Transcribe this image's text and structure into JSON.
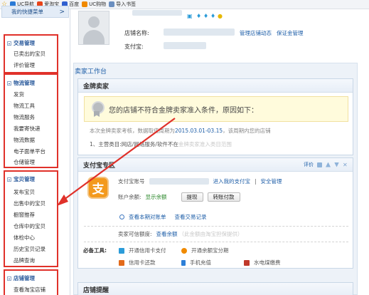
{
  "bookmarks": [
    {
      "label": "",
      "icon": "star-icon"
    },
    {
      "label": "UC导航",
      "icon": "uc-nav-icon",
      "color": "#2a7ad6"
    },
    {
      "label": "爱淘宝",
      "icon": "ai-taobao-icon",
      "color": "#e8441a"
    },
    {
      "label": "百度",
      "icon": "baidu-icon",
      "color": "#2f5fd0"
    },
    {
      "label": "UC购物",
      "icon": "uc-shopping-icon",
      "color": "#f08a00"
    },
    {
      "label": "导入书签",
      "icon": "import-bookmark-icon",
      "color": "#6b8fc0"
    }
  ],
  "sidebar": {
    "quick_menu": "我的快捷菜单",
    "quick_menu_arrow": ">",
    "groups": [
      {
        "title": "交易管理",
        "items": [
          "已卖出的宝贝",
          "评价管理"
        ]
      },
      {
        "title": "物流管理",
        "items": [
          "发货",
          "物流工具",
          "物流服务",
          "我要寄快递",
          "物流数据",
          "电子面单平台",
          "仓储管理"
        ]
      },
      {
        "title": "宝贝管理",
        "items": [
          "发布宝贝",
          "出售中的宝贝",
          "橱窗推荐",
          "仓库中的宝贝",
          "体检中心",
          "历史宝贝记录",
          "品牌查询"
        ]
      },
      {
        "title": "店铺管理",
        "items": [
          "查看淘宝店铺"
        ]
      }
    ]
  },
  "shop": {
    "name_label": "店铺名称:",
    "alipay_label": "支付宝:",
    "manage_dynamic": "管理店铺动态",
    "guarantee": "保证金管理"
  },
  "workbench": {
    "title": "卖家工作台",
    "gold": {
      "title": "金牌卖家",
      "warning": "您的店铺不符合金牌卖家准入条件，原因如下：",
      "period_prefix": "本次金牌卖家考核，数据取值周期为",
      "period": "2015.03.01-03.15",
      "period_suffix": "，该周期内您的店铺",
      "reason_prefix": "1、主营类目:网店/网络服务/软件不在",
      "reason_faint": "金牌卖家准入类目范围"
    },
    "alipay": {
      "title": "支付宝专区",
      "tools": {
        "rate": "评价"
      },
      "logo_char": "支",
      "account_label": "支付宝账号",
      "enter_link": "进入我的支付宝",
      "separator": "|",
      "security_link": "安全管理",
      "balance_label": "账户余额:",
      "show_balance": "显示余额",
      "withdraw": "提现",
      "transfer": "转账付款",
      "view_bill": "查看本期对账单",
      "view_records": "查看交易记录",
      "credit_label": "卖家可信额度:",
      "credit_view": "查看余额",
      "credit_faint": "（此金额由淘宝担保提供）",
      "must_tools_label": "必备工具:",
      "tools_list": [
        {
          "label": "开通信用卡支付",
          "icon": "credit-card-icon",
          "color": "#2c9cd9"
        },
        {
          "label": "开通余额宝分期",
          "icon": "installment-icon",
          "color": "#f08a00"
        },
        {
          "label": "信用卡还款",
          "icon": "card-repay-icon",
          "color": "#e26a1b"
        },
        {
          "label": "手机充值",
          "icon": "phone-recharge-icon",
          "color": "#2c7fd8"
        },
        {
          "label": "水电煤缴费",
          "icon": "utility-bill-icon",
          "color": "#c0392b"
        }
      ]
    },
    "notice_title": "店铺提醒"
  },
  "colors": {
    "annotation": "#e0312a",
    "link": "#1f5fa8",
    "alipay": "#f39a1e"
  }
}
